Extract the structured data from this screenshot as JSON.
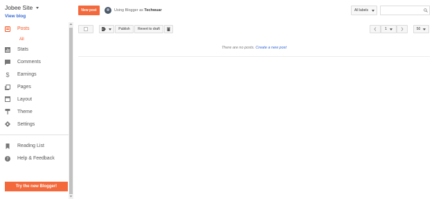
{
  "sidebar": {
    "site_title": "Jobee Site",
    "view_blog": "View blog",
    "items": [
      {
        "label": "Posts",
        "icon": "posts-icon",
        "active": true
      },
      {
        "label": "Stats",
        "icon": "stats-icon"
      },
      {
        "label": "Comments",
        "icon": "comments-icon"
      },
      {
        "label": "Earnings",
        "icon": "dollar-icon"
      },
      {
        "label": "Pages",
        "icon": "pages-icon"
      },
      {
        "label": "Layout",
        "icon": "layout-icon"
      },
      {
        "label": "Theme",
        "icon": "theme-icon"
      },
      {
        "label": "Settings",
        "icon": "gear-icon"
      }
    ],
    "sub_item": "All",
    "bottom_items": [
      {
        "label": "Reading List",
        "icon": "bookmark-icon"
      },
      {
        "label": "Help & Feedback",
        "icon": "help-icon"
      }
    ],
    "try_button": "Try the new Blogger!"
  },
  "header": {
    "new_post": "New post",
    "using_prefix": "Using Blogger as",
    "user_name": "Techwuar",
    "labels_filter": "All labels",
    "search_placeholder": ""
  },
  "toolbar": {
    "publish": "Publish",
    "revert": "Revert to draft",
    "page_number": "1",
    "per_page": "50"
  },
  "main": {
    "empty_text": "There are no posts.",
    "create_link": "Create a new post"
  },
  "colors": {
    "accent": "#f4693b",
    "link": "#3367d6"
  }
}
